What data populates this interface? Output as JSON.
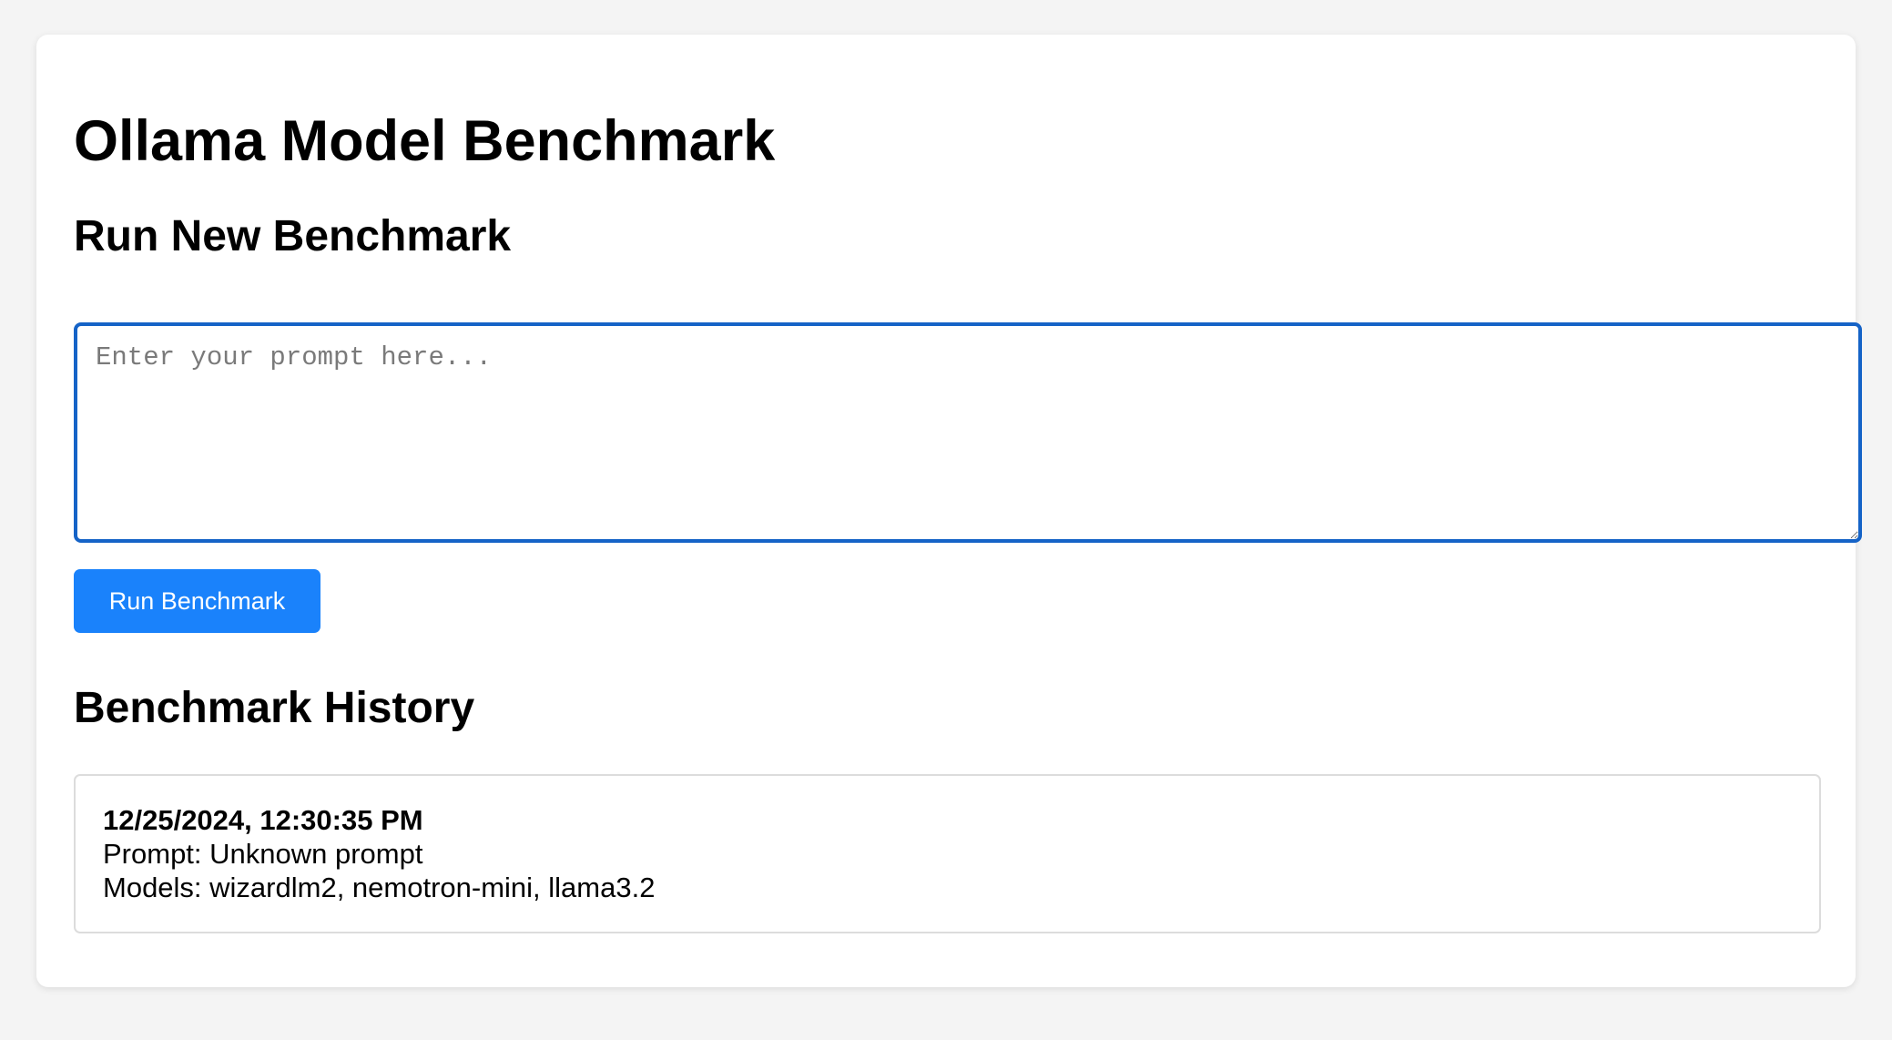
{
  "header": {
    "title": "Ollama Model Benchmark"
  },
  "run_section": {
    "title": "Run New Benchmark",
    "prompt_value": "",
    "prompt_placeholder": "Enter your prompt here...",
    "button_label": "Run Benchmark"
  },
  "history": {
    "title": "Benchmark History",
    "items": [
      {
        "timestamp": "12/25/2024, 12:30:35 PM",
        "prompt": "Prompt: Unknown prompt",
        "models": "Models: wizardlm2, nemotron-mini, llama3.2"
      }
    ]
  },
  "colors": {
    "accent": "#1a82fb",
    "focus_border": "#1563c7",
    "page_background": "#f4f4f4",
    "card_background": "#ffffff"
  }
}
